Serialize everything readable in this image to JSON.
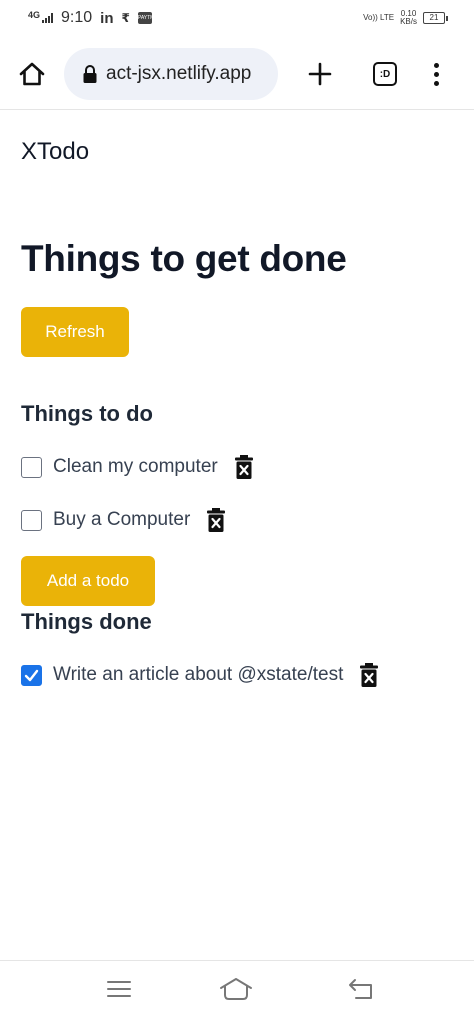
{
  "status_bar": {
    "network": "4G",
    "time": "9:10",
    "app_icon_1": "in",
    "app_icon_2": "₹",
    "app_badge": "PAYTM",
    "volte": "Vo)) LTE",
    "speed_value": "0.10",
    "speed_unit": "KB/s",
    "battery": "21"
  },
  "browser": {
    "url": "act-jsx.netlify.app",
    "tab_switcher_label": ":D"
  },
  "page": {
    "brand": "XTodo",
    "title": "Things to get done",
    "refresh_label": "Refresh",
    "todo_heading": "Things to do",
    "todos": [
      {
        "label": "Clean my computer",
        "checked": false
      },
      {
        "label": "Buy a Computer",
        "checked": false
      }
    ],
    "add_label": "Add a todo",
    "done_heading": "Things done",
    "done": [
      {
        "label": "Write an article about @xstate/test",
        "checked": true
      }
    ]
  },
  "colors": {
    "accent_button": "#eab308",
    "checkbox_checked": "#1a73e8",
    "url_bar_bg": "#eef1f8"
  },
  "icons": [
    "home-icon",
    "lock-icon",
    "plus-icon",
    "tab-switcher-icon",
    "more-vert-icon",
    "trash-icon",
    "menu-lines-icon",
    "nav-home-icon",
    "nav-back-icon"
  ]
}
